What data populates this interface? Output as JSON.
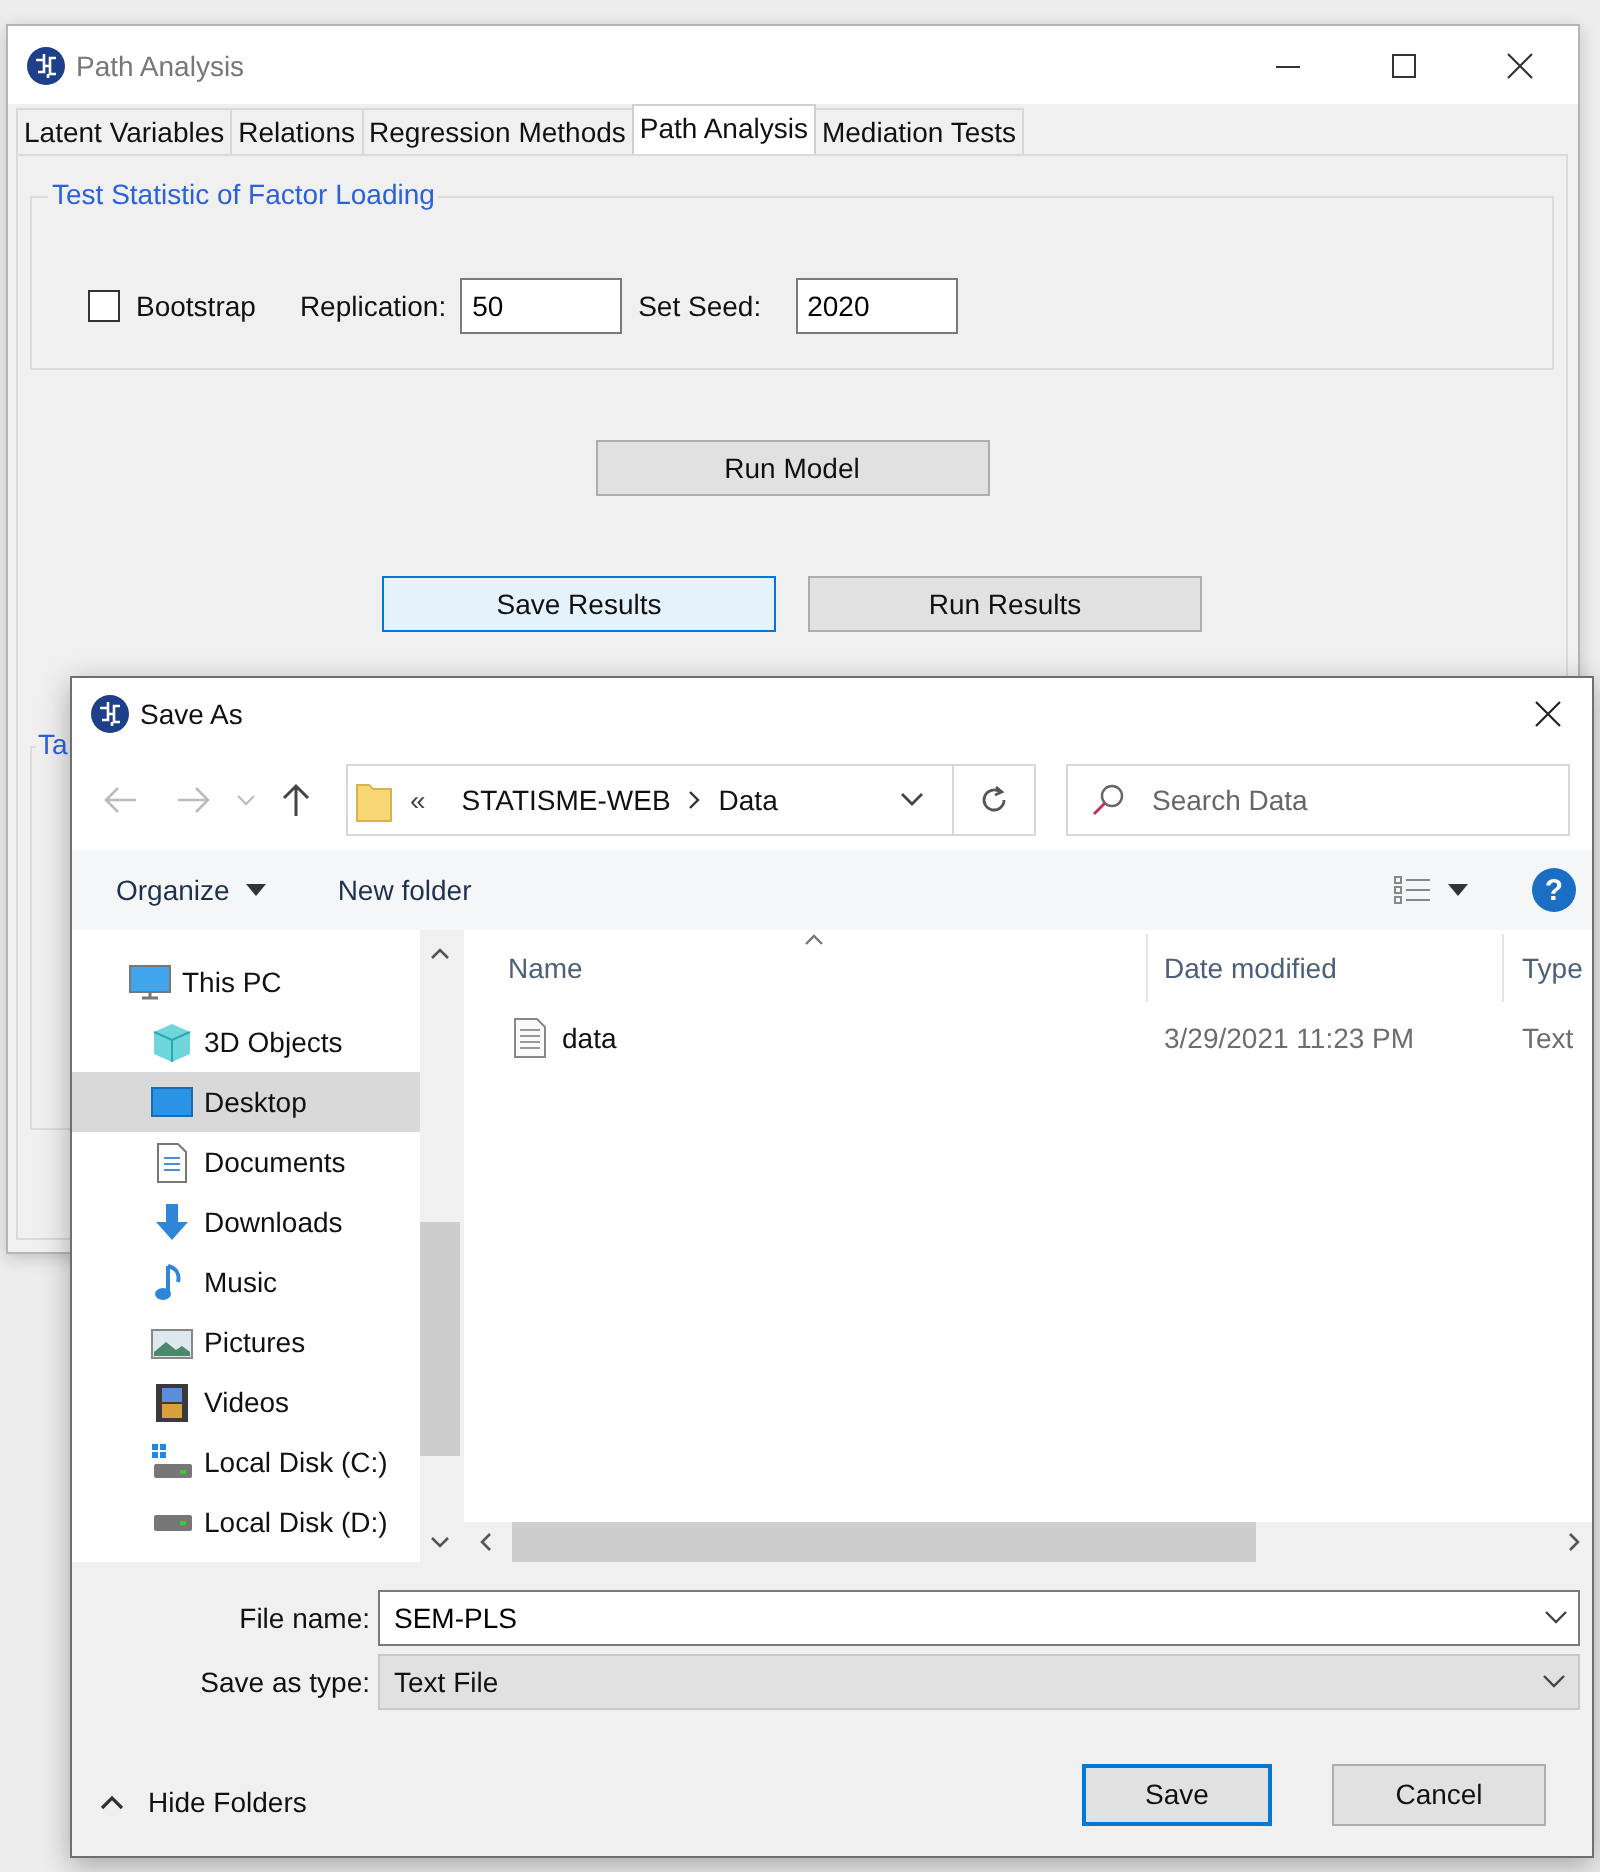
{
  "main_window": {
    "title": "Path Analysis",
    "tabs": [
      {
        "label": "Latent Variables",
        "selected": false
      },
      {
        "label": "Relations",
        "selected": false
      },
      {
        "label": "Regression Methods",
        "selected": false
      },
      {
        "label": "Path Analysis",
        "selected": true
      },
      {
        "label": "Mediation Tests",
        "selected": false
      }
    ],
    "factor_loading_group": {
      "title": "Test Statistic of Factor Loading",
      "bootstrap": {
        "label": "Bootstrap",
        "checked": false
      },
      "replication": {
        "label": "Replication:",
        "value": "50"
      },
      "seed": {
        "label": "Set Seed:",
        "value": "2020"
      }
    },
    "run_model_button": {
      "label": "Run Model",
      "focused": false
    },
    "result_buttons": [
      {
        "label": "Save Results",
        "focused": true
      },
      {
        "label": "Run Results",
        "focused": false
      }
    ],
    "lower_group": {
      "title": "Ta"
    }
  },
  "save_dialog": {
    "title": "Save As",
    "address": {
      "overflow": "«",
      "path": [
        "STATISME-WEB",
        "Data"
      ]
    },
    "search": {
      "placeholder": "Search Data"
    },
    "toolbar": {
      "organize": "Organize",
      "new_folder": "New folder",
      "help": "?"
    },
    "navigation": [
      {
        "label": "This PC",
        "kind": "pc",
        "selected": false,
        "children": [
          {
            "label": "3D Objects",
            "kind": "objects",
            "selected": false
          },
          {
            "label": "Desktop",
            "kind": "desktop",
            "selected": true
          },
          {
            "label": "Documents",
            "kind": "documents",
            "selected": false
          },
          {
            "label": "Downloads",
            "kind": "downloads",
            "selected": false
          },
          {
            "label": "Music",
            "kind": "music",
            "selected": false
          },
          {
            "label": "Pictures",
            "kind": "pictures",
            "selected": false
          },
          {
            "label": "Videos",
            "kind": "videos",
            "selected": false
          },
          {
            "label": "Local Disk (C:)",
            "kind": "system-disk",
            "selected": false
          },
          {
            "label": "Local Disk (D:)",
            "kind": "disk",
            "selected": false
          }
        ]
      }
    ],
    "columns": [
      {
        "label": "Name",
        "sorted": true
      },
      {
        "label": "Date modified",
        "sorted": false
      },
      {
        "label": "Type",
        "sorted": false
      }
    ],
    "files": [
      {
        "name": "data",
        "date_modified": "3/29/2021 11:23 PM",
        "type": "Text"
      }
    ],
    "file_name": {
      "label": "File name:",
      "value": "SEM-PLS"
    },
    "save_as_type": {
      "label": "Save as type:",
      "value": "Text File"
    },
    "hide_folders": "Hide Folders",
    "buttons": [
      {
        "label": "Save",
        "default": true
      },
      {
        "label": "Cancel",
        "default": false
      }
    ]
  }
}
